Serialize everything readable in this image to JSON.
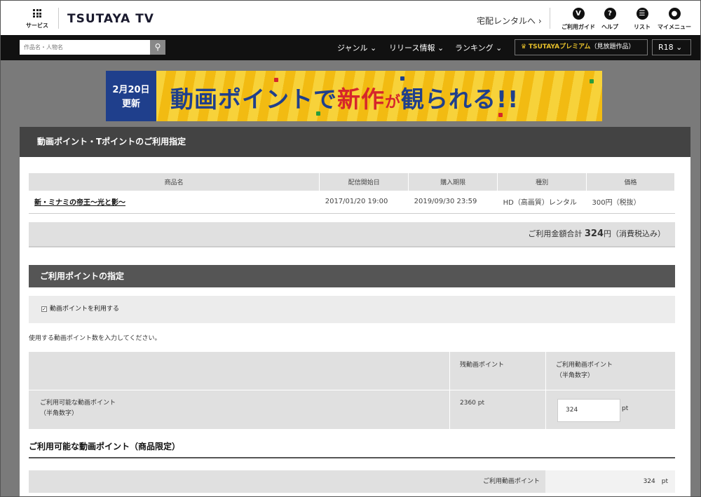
{
  "header": {
    "service_label": "サービス",
    "logo": "TSUTAYA TV",
    "takuhai_link": "宅配レンタルへ ›",
    "nav": [
      {
        "icon": "v-icon",
        "glyph": "V",
        "label": "ご利用ガイド"
      },
      {
        "icon": "help-icon",
        "glyph": "?",
        "label": "ヘルプ"
      },
      {
        "icon": "list-icon",
        "glyph": "☰",
        "label": "リスト"
      },
      {
        "icon": "user-icon",
        "glyph": "●",
        "label": "マイメニュー"
      }
    ]
  },
  "navbar": {
    "search_placeholder": "作品名・人物名",
    "search_icon": "search-icon",
    "menu": [
      "ジャンル ⌄",
      "リリース情報 ⌄",
      "ランキング ⌄"
    ],
    "premium_prefix": "TSUTAYA",
    "premium_brand": "プレミアム",
    "premium_suffix": "（見放題作品）",
    "r18": "R18 ⌄"
  },
  "banner": {
    "date_line1": "2月20日",
    "date_line2": "更新",
    "title_a": "動画ポイントで",
    "title_b": "新作",
    "title_c": "が",
    "title_d": "観られる!!"
  },
  "page": {
    "title": "動画ポイント・Tポイントのご利用指定",
    "items_table": {
      "headers": [
        "商品名",
        "配信開始日",
        "購入期限",
        "種別",
        "価格"
      ],
      "rows": [
        [
          "新・ミナミの帝王～光と影～",
          "2017/01/20 19:00",
          "2019/09/30 23:59",
          "HD（高画質）レンタル",
          "300円（税抜）"
        ]
      ]
    },
    "total_label": "ご利用金額合計",
    "total_value": "324",
    "total_unit": "円（消費税込み）",
    "points_section_title": "ご利用ポイントの指定",
    "use_points_checkbox": "動画ポイントを利用する",
    "instruction": "使用する動画ポイント数を入力してください。",
    "points_table": {
      "col_remaining": "残動画ポイント",
      "col_use_line1": "ご利用動画ポイント",
      "col_use_line2": "（半角数字）",
      "row_label_line1": "ご利用可能な動画ポイント",
      "row_label_line2": "（半角数字）",
      "remaining_value": "2360 pt",
      "input_value": "324",
      "input_unit": "pt"
    },
    "limited_title": "ご利用可能な動画ポイント（商品限定）",
    "used_label": "ご利用動画ポイント",
    "used_value": "324　pt"
  }
}
